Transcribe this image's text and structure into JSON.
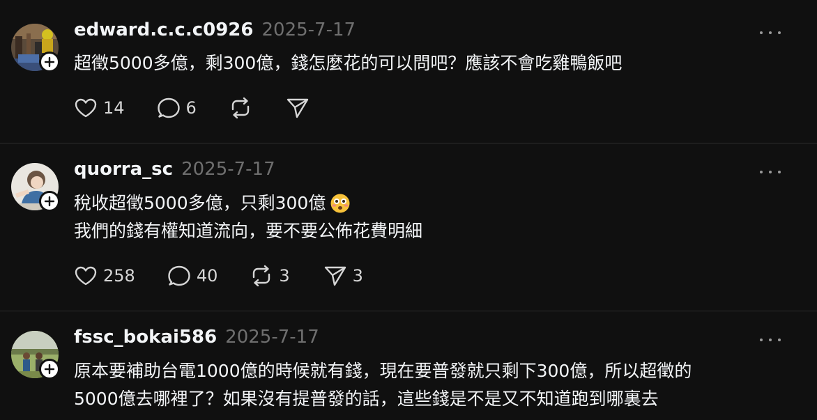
{
  "posts": [
    {
      "username": "edward.c.c.c0926",
      "date": "2025-7-17",
      "lines": [
        "超徵5000多億，剩300億，錢怎麼花的可以問吧？應該不會吃雞鴨飯吧"
      ],
      "likes": "14",
      "replies": "6",
      "reposts": "",
      "shares": ""
    },
    {
      "username": "quorra_sc",
      "date": "2025-7-17",
      "lines": [
        "稅收超徵5000多億，只剩300億",
        "我們的錢有權知道流向，要不要公佈花費明細"
      ],
      "emoji": "flushed-face-emoji",
      "likes": "258",
      "replies": "40",
      "reposts": "3",
      "shares": "3"
    },
    {
      "username": "fssc_bokai586",
      "date": "2025-7-17",
      "lines": [
        "原本要補助台電1000億的時候就有錢，現在要普發就只剩下300億，所以超徵的",
        "5000億去哪裡了？如果沒有提普發的話，這些錢是不是又不知道跑到哪裏去"
      ]
    }
  ],
  "colors": {
    "background": "#101010",
    "text": "#f3f5f7",
    "muted": "#6f6f6f",
    "separator": "#2d2d2d"
  }
}
